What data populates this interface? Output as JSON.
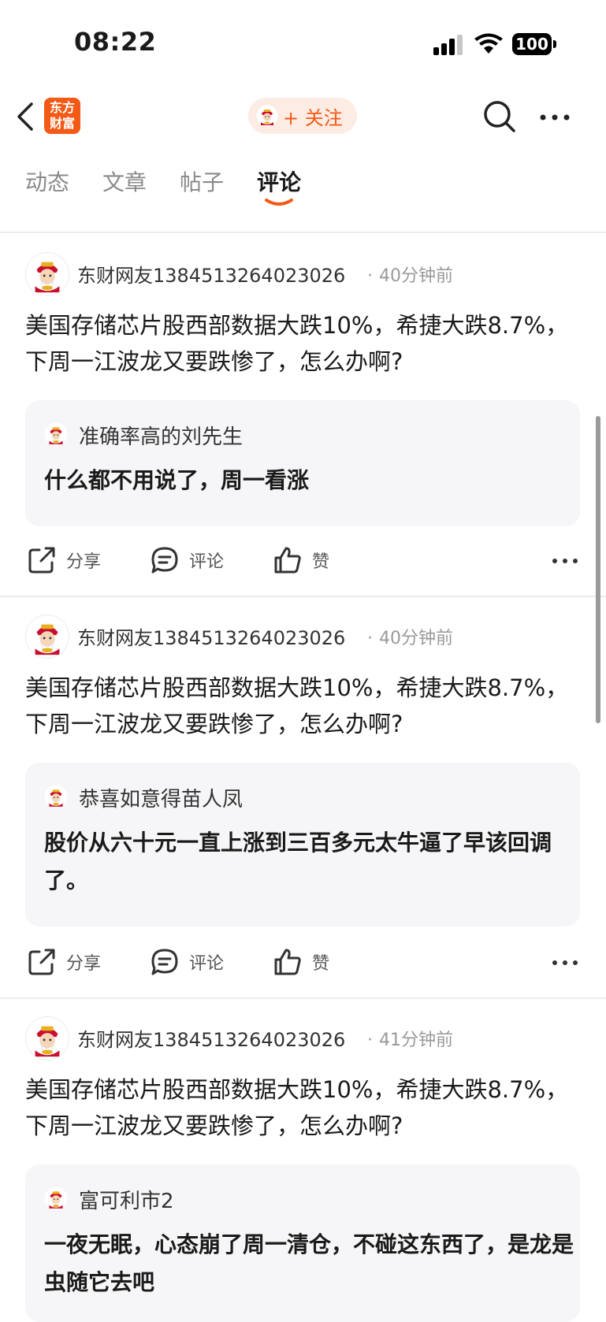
{
  "status": {
    "time": "08:22",
    "battery": "100"
  },
  "nav": {
    "logo_line1": "东方",
    "logo_line2": "财富",
    "follow_label": "+ 关注"
  },
  "tabs": [
    {
      "label": "动态"
    },
    {
      "label": "文章"
    },
    {
      "label": "帖子"
    },
    {
      "label": "评论"
    }
  ],
  "active_tab": "评论",
  "posts": [
    {
      "author": "东财网友1384513264023026",
      "time": "40分钟前",
      "text": "美国存储芯片股西部数据大跌10%，希捷大跌8.7%，下周一江波龙又要跌惨了，怎么办啊?",
      "reply": {
        "name": "准确率高的刘先生",
        "text": "什么都不用说了，周一看涨"
      }
    },
    {
      "author": "东财网友1384513264023026",
      "time": "40分钟前",
      "text": "美国存储芯片股西部数据大跌10%，希捷大跌8.7%，下周一江波龙又要跌惨了，怎么办啊?",
      "reply": {
        "name": "恭喜如意得苗人凤",
        "text": "股价从六十元一直上涨到三百多元太牛逼了早该回调了。"
      }
    },
    {
      "author": "东财网友1384513264023026",
      "time": "41分钟前",
      "text": "美国存储芯片股西部数据大跌10%，希捷大跌8.7%，下周一江波龙又要跌惨了，怎么办啊?",
      "reply": {
        "name": "富可利市2",
        "text": "一夜无眠，心态崩了周一清仓，不碰这东西了，是龙是虫随它去吧"
      }
    }
  ],
  "actions": {
    "share": "分享",
    "comment": "评论",
    "like": "赞"
  },
  "colors": {
    "accent": "#f25a16",
    "follow_bg": "#fdece4",
    "quote_bg": "#f6f6f8",
    "divider": "#ececec"
  }
}
